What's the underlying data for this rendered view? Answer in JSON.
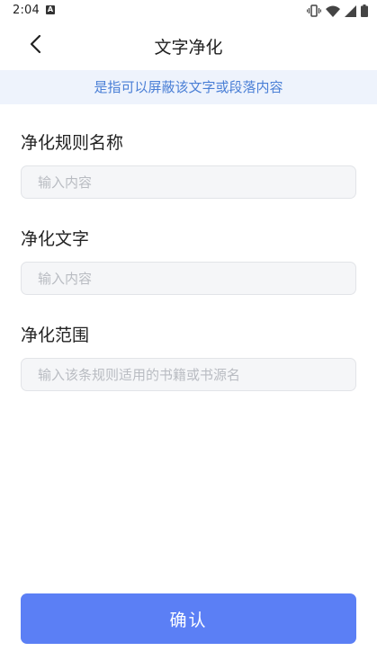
{
  "status_bar": {
    "time": "2:04",
    "notification_badge": "A",
    "icons": [
      "vibrate-icon",
      "wifi-icon",
      "signal-icon",
      "battery-icon"
    ]
  },
  "header": {
    "title": "文字净化",
    "back_icon": "chevron-left-icon"
  },
  "banner": {
    "text": "是指可以屏蔽该文字或段落内容"
  },
  "form": {
    "rule_name": {
      "label": "净化规则名称",
      "placeholder": "输入内容",
      "value": ""
    },
    "purify_text": {
      "label": "净化文字",
      "placeholder": "输入内容",
      "value": ""
    },
    "scope": {
      "label": "净化范围",
      "placeholder": "输入该条规则适用的书籍或书源名",
      "value": ""
    }
  },
  "actions": {
    "confirm_label": "确认"
  },
  "colors": {
    "accent": "#5b7ff5",
    "banner_bg": "#eef3fc",
    "banner_text": "#4a7fd6",
    "input_bg": "#f5f6f8",
    "placeholder": "#b9bcc2"
  }
}
